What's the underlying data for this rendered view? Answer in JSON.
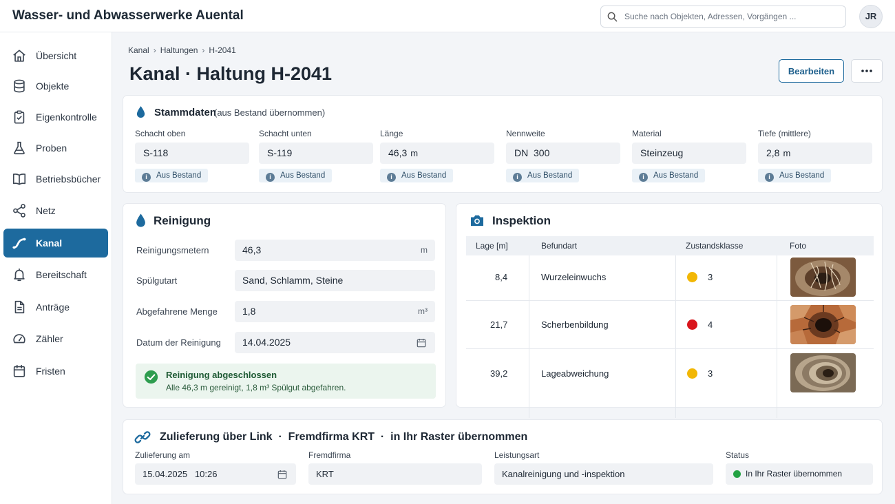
{
  "app": {
    "title": "Wasser- und Abwasserwerke Auental"
  },
  "search": {
    "placeholder": "Suche nach Objekten, Adressen, Vorgängen ..."
  },
  "user": {
    "initials": "JR"
  },
  "sidebar": {
    "items": [
      {
        "label": "Übersicht",
        "icon": "home-icon"
      },
      {
        "label": "Objekte",
        "icon": "database-icon"
      },
      {
        "label": "Eigenkontrolle",
        "icon": "clipboard-check-icon"
      },
      {
        "label": "Proben",
        "icon": "flask-icon"
      },
      {
        "label": "Betriebsbücher",
        "icon": "book-icon"
      },
      {
        "label": "Netz",
        "icon": "share-nodes-icon"
      },
      {
        "label": "Kanal",
        "icon": "pipe-icon",
        "active": true
      },
      {
        "label": "Bereitschaft",
        "icon": "bell-icon"
      },
      {
        "label": "Anträge",
        "icon": "document-icon"
      },
      {
        "label": "Zähler",
        "icon": "gauge-icon"
      },
      {
        "label": "Fristen",
        "icon": "calendar-icon"
      }
    ]
  },
  "breadcrumb": [
    "Kanal",
    "Haltungen",
    "H-2041"
  ],
  "page": {
    "title": "Kanal · Haltung H-2041",
    "edit_label": "Bearbeiten",
    "more_label": "···"
  },
  "stammdaten": {
    "title": "Stammdaten",
    "subtitle": "(aus Bestand übernommen)",
    "badge": "Aus Bestand",
    "fields": [
      {
        "label": "Schacht oben",
        "value": "S-118",
        "unit": ""
      },
      {
        "label": "Schacht unten",
        "value": "S-119",
        "unit": ""
      },
      {
        "label": "Länge",
        "value": "46,3",
        "unit": "m"
      },
      {
        "label": "Nennweite",
        "value": "DN  300",
        "unit": ""
      },
      {
        "label": "Material",
        "value": "Steinzeug",
        "unit": ""
      },
      {
        "label": "Tiefe (mittlere)",
        "value": "2,8",
        "unit": "m"
      }
    ]
  },
  "reinigung": {
    "title": "Reinigung",
    "rows": [
      {
        "label": "Reinigungsmetern",
        "value": "46,3",
        "unit": "m"
      },
      {
        "label": "Spülgutart",
        "value": "Sand, Schlamm, Steine",
        "unit": ""
      },
      {
        "label": "Abgefahrene Menge",
        "value": "1,8",
        "unit": "m³"
      },
      {
        "label": "Datum der Reinigung",
        "value": "14.04.2025",
        "unit": ""
      }
    ],
    "success_title": "Reinigung abgeschlossen",
    "success_text": "Alle 46,3 m gereinigt, 1,8 m³ Spülgut abgefahren."
  },
  "inspektion": {
    "title": "Inspektion",
    "columns": [
      "Lage [m]",
      "Befundart",
      "Zustandsklasse",
      "Foto"
    ],
    "rows": [
      {
        "lage": "8,4",
        "befund": "Wurzeleinwuchs",
        "klasse": "3",
        "color": "#f2b705"
      },
      {
        "lage": "21,7",
        "befund": "Scherbenbildung",
        "klasse": "4",
        "color": "#d9151c"
      },
      {
        "lage": "39,2",
        "befund": "Lageabweichung",
        "klasse": "3",
        "color": "#f2b705"
      }
    ]
  },
  "zulieferung": {
    "title": "Zulieferung über Link  ·  Fremdfirma KRT  ·  in Ihr Raster übernommen",
    "fields": [
      {
        "label": "Zulieferung am",
        "value": "15.04.2025   10:26"
      },
      {
        "label": "Fremdfirma",
        "value": "KRT"
      },
      {
        "label": "Leistungsart",
        "value": "Kanalreinigung und -inspektion"
      },
      {
        "label": "Status",
        "value": "In Ihr Raster übernommen"
      }
    ]
  },
  "colors": {
    "accent": "#1d6a9e",
    "success": "#2e9d4f",
    "status_green": "#23a243"
  }
}
